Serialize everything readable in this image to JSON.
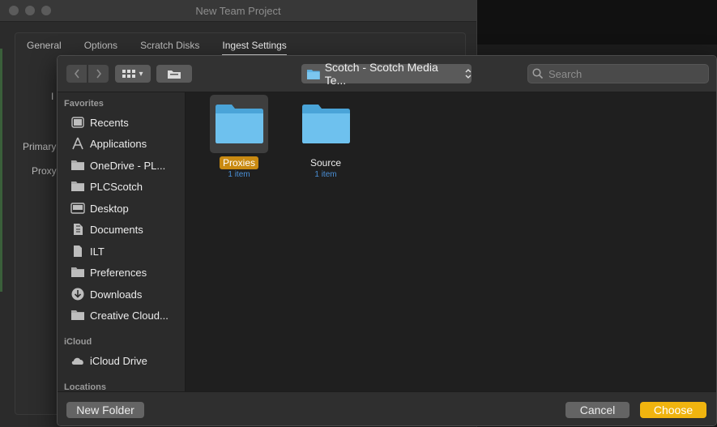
{
  "background_window": {
    "title": "New Team Project",
    "tabs": [
      {
        "label": "General",
        "active": false
      },
      {
        "label": "Options",
        "active": false
      },
      {
        "label": "Scratch Disks",
        "active": false
      },
      {
        "label": "Ingest Settings",
        "active": true
      }
    ],
    "labels": {
      "first": "I",
      "primary": "Primary",
      "proxy": "Proxy"
    }
  },
  "dialog": {
    "toolbar": {
      "back_icon": "chevron-left-icon",
      "forward_icon": "chevron-right-icon",
      "view_icon": "grid-view-icon",
      "view_chevron": "▾",
      "group_icon": "folder-group-icon",
      "path_label": "Scotch - Scotch Media Te...",
      "path_chevron": "⌃⌄"
    },
    "search": {
      "placeholder": "Search",
      "value": ""
    },
    "sidebar": {
      "favorites_header": "Favorites",
      "favorites": [
        {
          "label": "Recents",
          "icon": "clock-icon"
        },
        {
          "label": "Applications",
          "icon": "applications-icon"
        },
        {
          "label": "OneDrive - PL...",
          "icon": "folder-icon"
        },
        {
          "label": "PLCScotch",
          "icon": "folder-icon"
        },
        {
          "label": "Desktop",
          "icon": "desktop-icon"
        },
        {
          "label": "Documents",
          "icon": "document-icon"
        },
        {
          "label": "ILT",
          "icon": "file-icon"
        },
        {
          "label": "Preferences",
          "icon": "folder-icon"
        },
        {
          "label": "Downloads",
          "icon": "download-icon"
        },
        {
          "label": "Creative Cloud...",
          "icon": "folder-icon"
        }
      ],
      "icloud_header": "iCloud",
      "icloud": [
        {
          "label": "iCloud Drive",
          "icon": "cloud-icon"
        }
      ],
      "locations_header": "Locations"
    },
    "files": [
      {
        "name": "Proxies",
        "meta": "1 item",
        "selected": true
      },
      {
        "name": "Source",
        "meta": "1 item",
        "selected": false
      }
    ],
    "buttons": {
      "new_folder": "New Folder",
      "cancel": "Cancel",
      "choose": "Choose"
    }
  },
  "colors": {
    "accent": "#f0b40f",
    "selection_label": "#c98a12",
    "folder": "#5fb3e4",
    "meta": "#4a8fd6"
  }
}
